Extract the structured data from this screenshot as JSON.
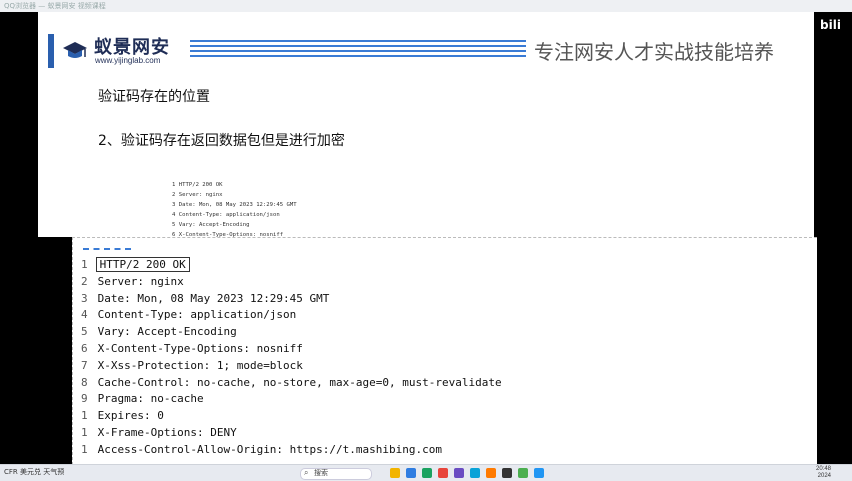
{
  "window": {
    "title": "QQ浏览器 — 蚁景网安 视频课程"
  },
  "watermark": {
    "text": "bili"
  },
  "slide": {
    "logo": {
      "cn": "蚁景网安",
      "en": "www.yijinglab.com"
    },
    "slogan": "专注网安人才实战技能培养",
    "heading1": "验证码存在的位置",
    "heading2": "2、验证码存在返回数据包但是进行加密",
    "small_code": [
      "1 HTTP/2 200 OK",
      "2 Server: nginx",
      "3 Date: Mon, 08 May 2023 12:29:45 GMT",
      "4 Content-Type: application/json",
      "5 Vary: Accept-Encoding",
      "6 X-Content-Type-Options: nosniff"
    ]
  },
  "code": {
    "lines": [
      {
        "n": "1",
        "text": "HTTP/2 200 OK"
      },
      {
        "n": "2",
        "text": "Server: nginx"
      },
      {
        "n": "3",
        "text": "Date: Mon, 08 May 2023 12:29:45 GMT"
      },
      {
        "n": "4",
        "text": "Content-Type: application/json"
      },
      {
        "n": "5",
        "text": "Vary: Accept-Encoding"
      },
      {
        "n": "6",
        "text": "X-Content-Type-Options: nosniff"
      },
      {
        "n": "7",
        "text": "X-Xss-Protection: 1; mode=block"
      },
      {
        "n": "8",
        "text": "Cache-Control: no-cache, no-store, max-age=0, must-revalidate"
      },
      {
        "n": "9",
        "text": "Pragma: no-cache"
      },
      {
        "n": "1",
        "text": "Expires: 0"
      },
      {
        "n": "1",
        "text": "X-Frame-Options: DENY"
      },
      {
        "n": "1",
        "text": "Access-Control-Allow-Origin: https://t.mashibing.com"
      }
    ]
  },
  "taskbar": {
    "left_text": "CFR 美元兑 天气预",
    "search": "搜索",
    "clock": {
      "time": "20:48",
      "date": "2024"
    },
    "icon_colors": [
      "#f2b400",
      "#2f7de1",
      "#1aa260",
      "#e8453c",
      "#6a4cc2",
      "#0aa3d8",
      "#ff7a00",
      "#333333",
      "#4caf50",
      "#2196f3"
    ]
  }
}
